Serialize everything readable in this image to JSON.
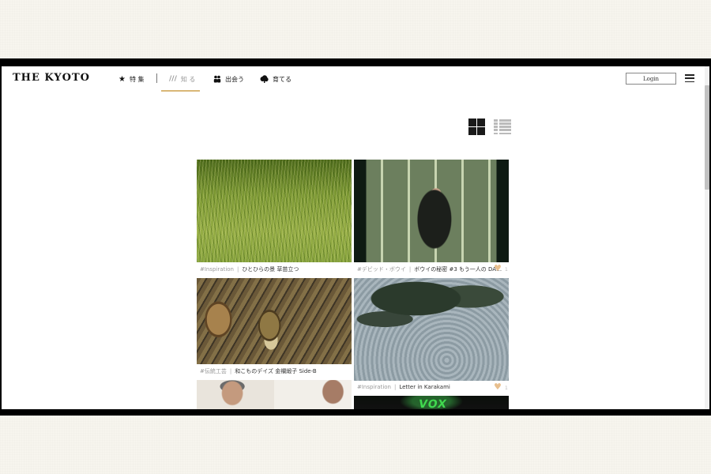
{
  "header": {
    "logo": "THE KYOTO",
    "nav": [
      {
        "label": "特 集",
        "icon": "star-icon"
      },
      {
        "label": "知 る",
        "icon": "bars-icon",
        "active": true
      },
      {
        "label": "出会う",
        "icon": "people-icon"
      },
      {
        "label": "育てる",
        "icon": "tree-icon"
      }
    ],
    "login_label": "Login"
  },
  "colors": {
    "accent_underline": "#d9b777",
    "heart": "#e8bf8e",
    "tag": "#999999"
  },
  "cards": [
    {
      "tag": "#Inspiration",
      "title": "ひとひらの景 草苗立つ"
    },
    {
      "tag": "#デビッド・ボウイ",
      "title": "ボウイの秘密 #3 もう一人の DA…",
      "likes": "1"
    },
    {
      "tag": "#伝統工芸",
      "title": "和こものデイズ 金襴緞子 Side-B"
    },
    {
      "tag": "#Inspiration",
      "title": "Letter in Karakami",
      "likes": "1"
    },
    {
      "sign_text": "VOX"
    }
  ]
}
